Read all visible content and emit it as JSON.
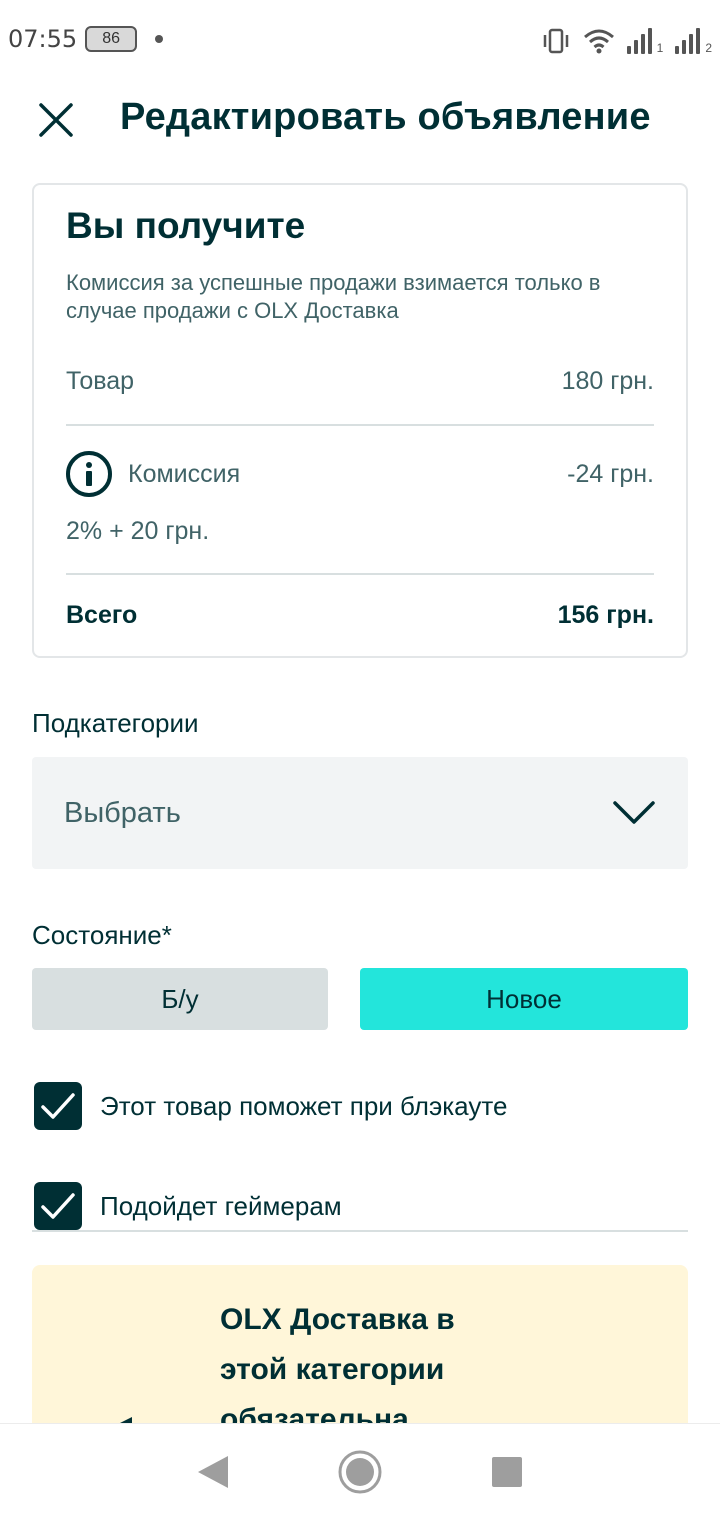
{
  "status_bar": {
    "time": "07:55",
    "battery": "86",
    "sim1": "1",
    "sim2": "2"
  },
  "header": {
    "title": "Редактировать объявление"
  },
  "summary": {
    "title": "Вы получите",
    "note": "Комиссия за успешные продажи взимается только в случае продажи с OLX Доставка",
    "item_label": "Товар",
    "item_value": "180 грн.",
    "commission_label": "Комиссия",
    "commission_value": "-24 грн.",
    "commission_formula": "2% + 20 грн.",
    "total_label": "Всего",
    "total_value": "156 грн."
  },
  "subcategory": {
    "label": "Подкатегории",
    "value": "Выбрать"
  },
  "condition": {
    "label": "Состояние*",
    "options": [
      "Б/у",
      "Новое"
    ],
    "selected": "Новое"
  },
  "checkboxes": [
    {
      "label": "Этот товар поможет при блэкауте",
      "checked": true
    },
    {
      "label": "Подойдет геймерам",
      "checked": true
    }
  ],
  "delivery_banner": {
    "text": "OLX Доставка в этой категории обязательна"
  },
  "colors": {
    "primary": "#002f34",
    "accent": "#23e5db",
    "muted_text": "#406367",
    "banner_bg": "#fff6d9"
  }
}
